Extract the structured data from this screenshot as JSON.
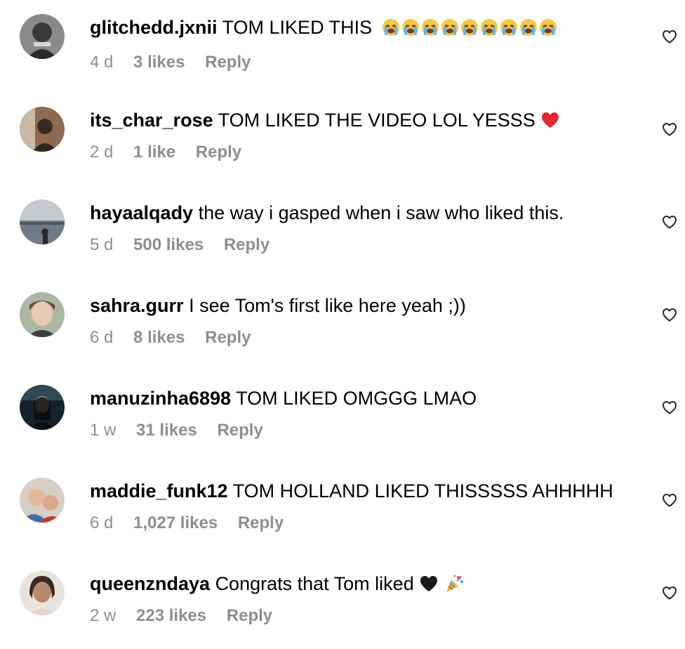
{
  "comments": [
    {
      "username": "glitchedd.jxnii",
      "text": "TOM LIKED THIS",
      "time": "4 d",
      "likes": "3 likes",
      "reply": "Reply",
      "emoji": "loudly-crying-face x9",
      "avatar_color": "#6b6b6b"
    },
    {
      "username": "its_char_rose",
      "text": "TOM LIKED THE VIDEO LOL YESSS",
      "time": "2 d",
      "likes": "1 like",
      "reply": "Reply",
      "emoji": "red-heart",
      "avatar_color": "#7a5a43"
    },
    {
      "username": "hayaalqady",
      "text": "the way i gasped when i saw who liked this.",
      "time": "5 d",
      "likes": "500 likes",
      "reply": "Reply",
      "avatar_color": "#b9bcc4"
    },
    {
      "username": "sahra.gurr",
      "text": "I see Tom's first like here yeah ;))",
      "time": "6 d",
      "likes": "8 likes",
      "reply": "Reply",
      "avatar_color": "#9fae9c"
    },
    {
      "username": "manuzinha6898",
      "text": "TOM LIKED OMGGG LMAO",
      "time": "1 w",
      "likes": "31 likes",
      "reply": "Reply",
      "avatar_color": "#1d2b33"
    },
    {
      "username": "maddie_funk12",
      "text": "TOM HOLLAND LIKED THISSSSS AHHHHH",
      "time": "6 d",
      "likes": "1,027 likes",
      "reply": "Reply",
      "avatar_color": "#5a7fa6"
    },
    {
      "username": "queenzndaya",
      "text": "Congrats that Tom liked",
      "time": "2 w",
      "likes": "223 likes",
      "reply": "Reply",
      "emoji": "black-heart party-popper",
      "avatar_color": "#5b4a3f"
    }
  ],
  "colors": {
    "text": "#000000",
    "meta": "#8e8e8e",
    "heart_outline": "#262626"
  },
  "icons": {
    "like": "heart-outline-icon"
  }
}
